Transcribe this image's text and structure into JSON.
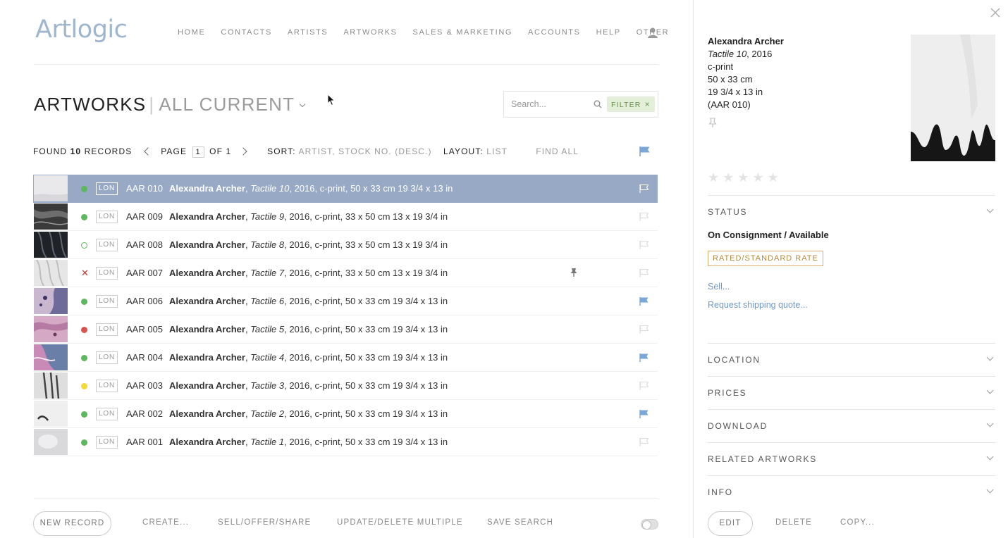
{
  "app": {
    "logo": "Artlogic"
  },
  "nav": [
    "HOME",
    "CONTACTS",
    "ARTISTS",
    "ARTWORKS",
    "SALES & MARKETING",
    "ACCOUNTS",
    "HELP",
    "OTHER"
  ],
  "page": {
    "title": "ARTWORKS",
    "separator": "|",
    "subtitle": "ALL CURRENT"
  },
  "search": {
    "placeholder": "Search...",
    "filter_label": "FILTER",
    "filter_remove": "×"
  },
  "records": {
    "found_label": "FOUND",
    "count": "10",
    "records_label": "RECORDS",
    "page_label": "PAGE",
    "page": "1",
    "of_label": "OF 1",
    "sort_label": "SORT:",
    "sort_value": "ARTIST, STOCK NO. (DESC.)",
    "layout_label": "LAYOUT:",
    "layout_value": "LIST",
    "find_all": "FIND ALL"
  },
  "artworks": [
    {
      "stock": "AAR 010",
      "artist": "Alexandra Archer",
      "title": "Tactile 10",
      "details": ", 2016, c-print, 50 x 33 cm 19 3/4 x 13 in",
      "location": "LON",
      "status": "green",
      "flagged": false,
      "pinned": false,
      "selected": true,
      "thumb": "white"
    },
    {
      "stock": "AAR 009",
      "artist": "Alexandra Archer",
      "title": "Tactile 9",
      "details": ", 2016, c-print, 33 x 50 cm 13 x 19 3/4 in",
      "location": "LON",
      "status": "green",
      "flagged": false,
      "pinned": false,
      "selected": false,
      "thumb": "dark"
    },
    {
      "stock": "AAR 008",
      "artist": "Alexandra Archer",
      "title": "Tactile 8",
      "details": ", 2016, c-print, 33 x 50 cm 13 x 19 3/4 in",
      "location": "LON",
      "status": "hollow",
      "flagged": false,
      "pinned": false,
      "selected": false,
      "thumb": "darker"
    },
    {
      "stock": "AAR 007",
      "artist": "Alexandra Archer",
      "title": "Tactile 7",
      "details": ", 2016, c-print, 33 x 50 cm 13 x 19 3/4 in",
      "location": "LON",
      "status": "cross",
      "flagged": false,
      "pinned": true,
      "selected": false,
      "thumb": "light"
    },
    {
      "stock": "AAR 006",
      "artist": "Alexandra Archer",
      "title": "Tactile 6",
      "details": ", 2016, c-print, 50 x 33 cm 19 3/4 x 13 in",
      "location": "LON",
      "status": "green",
      "flagged": true,
      "pinned": false,
      "selected": false,
      "thumb": "purple"
    },
    {
      "stock": "AAR 005",
      "artist": "Alexandra Archer",
      "title": "Tactile 5",
      "details": ", 2016, c-print, 50 x 33 cm 19 3/4 x 13 in",
      "location": "LON",
      "status": "red",
      "flagged": false,
      "pinned": false,
      "selected": false,
      "thumb": "pink"
    },
    {
      "stock": "AAR 004",
      "artist": "Alexandra Archer",
      "title": "Tactile 4",
      "details": ", 2016, c-print, 50 x 33 cm 19 3/4 x 13 in",
      "location": "LON",
      "status": "green",
      "flagged": true,
      "pinned": false,
      "selected": false,
      "thumb": "magenta"
    },
    {
      "stock": "AAR 003",
      "artist": "Alexandra Archer",
      "title": "Tactile 3",
      "details": ", 2016, c-print, 50 x 33 cm 19 3/4 x 13 in",
      "location": "LON",
      "status": "yellow",
      "flagged": false,
      "pinned": false,
      "selected": false,
      "thumb": "grey"
    },
    {
      "stock": "AAR 002",
      "artist": "Alexandra Archer",
      "title": "Tactile 2",
      "details": ", 2016, c-print, 50 x 33 cm 19 3/4 x 13 in",
      "location": "LON",
      "status": "green",
      "flagged": true,
      "pinned": false,
      "selected": false,
      "thumb": "pale"
    },
    {
      "stock": "AAR 001",
      "artist": "Alexandra Archer",
      "title": "Tactile 1",
      "details": ", 2016, c-print, 50 x 33 cm 19 3/4 x 13 in",
      "location": "LON",
      "status": "green",
      "flagged": false,
      "pinned": false,
      "selected": false,
      "thumb": "softgrey"
    }
  ],
  "footer": {
    "new_record": "NEW RECORD",
    "create": "CREATE...",
    "sell_offer_share": "SELL/OFFER/SHARE",
    "update_delete": "UPDATE/DELETE MULTIPLE",
    "save_search": "SAVE SEARCH"
  },
  "detail": {
    "artist": "Alexandra Archer",
    "title": "Tactile 10",
    "year": ", 2016",
    "medium": "c-print",
    "dims_cm": "50 x 33 cm",
    "dims_in": "19 3/4 x 13 in",
    "stock": "(AAR 010)",
    "rating_stars": "★★★★★",
    "rating": 0,
    "sections": {
      "status": "STATUS",
      "location": "LOCATION",
      "prices": "PRICES",
      "download": "DOWNLOAD",
      "related": "RELATED ARTWORKS",
      "info": "INFO"
    },
    "status_value": "On Consignment / Available",
    "rate_badge": "RATED/STANDARD RATE",
    "sell_link": "Sell...",
    "shipping_link": "Request shipping quote...",
    "edit": "EDIT",
    "delete": "DELETE",
    "copy": "COPY..."
  },
  "colors": {
    "accent": "#6f98c6",
    "selected_row": "#97a9c5",
    "logo": "#9fb6cf",
    "flag": "#7aa7d8",
    "status_green": "#5cb85c",
    "status_red": "#d9534f",
    "status_yellow": "#f3d836"
  }
}
